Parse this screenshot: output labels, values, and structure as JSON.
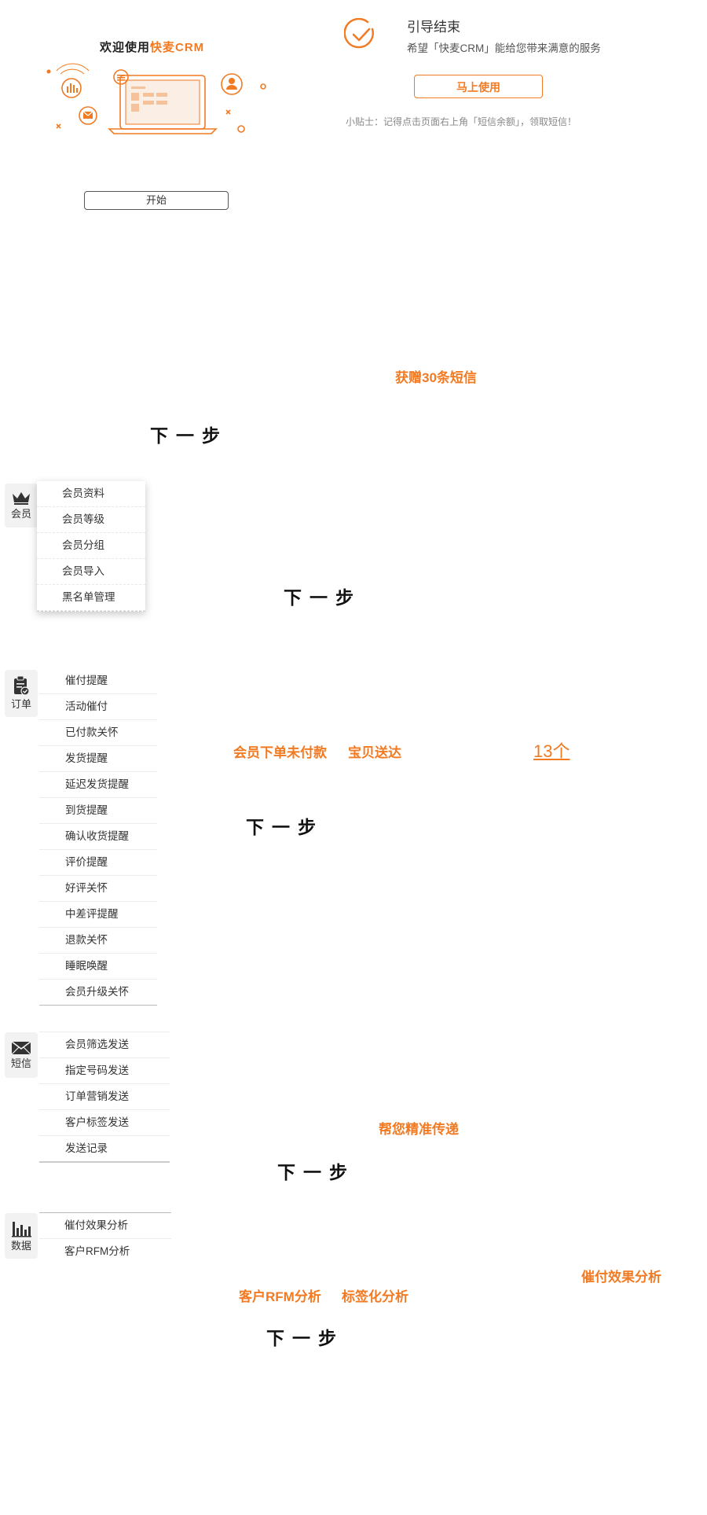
{
  "welcome": {
    "title_prefix": "欢迎使用",
    "brand": "快麦CRM",
    "start_button": "开始"
  },
  "guide_end": {
    "title": "引导结束",
    "subtitle": "希望「快麦CRM」能给您带来满意的服务",
    "use_button": "马上使用",
    "tip": "小贴士：记得点击页面右上角「短信余额」，领取短信！"
  },
  "gift_sms": "获赠30条短信",
  "next_label": "下一步",
  "member": {
    "tab_label": "会员",
    "items": [
      "会员资料",
      "会员等级",
      "会员分组",
      "会员导入",
      "黑名单管理"
    ]
  },
  "order": {
    "tab_label": "订单",
    "items": [
      "催付提醒",
      "活动催付",
      "已付款关怀",
      "发货提醒",
      "延迟发货提醒",
      "到货提醒",
      "确认收货提醒",
      "评价提醒",
      "好评关怀",
      "中差评提醒",
      "退款关怀",
      "睡眠唤醒",
      "会员升级关怀"
    ],
    "highlight_unpaid": "会员下单未付款",
    "highlight_delivered": "宝贝送达",
    "count_link": "13个"
  },
  "sms": {
    "tab_label": "短信",
    "items": [
      "会员筛选发送",
      "指定号码发送",
      "订单营销发送",
      "客户标签发送",
      "发送记录"
    ],
    "highlight": "帮您精准传递"
  },
  "data": {
    "tab_label": "数据",
    "items": [
      "催付效果分析",
      "客户RFM分析"
    ],
    "highlight_effect": "催付效果分析",
    "highlight_rfm": "客户RFM分析",
    "highlight_tag": "标签化分析"
  },
  "colors": {
    "accent": "#f27a22",
    "text": "#333333",
    "tab_bg": "#f2f2f2"
  }
}
